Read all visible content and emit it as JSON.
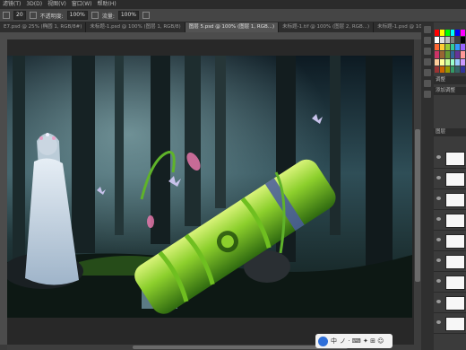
{
  "menubar": {
    "items": [
      "滤镜(T)",
      "3D(D)",
      "视图(V)",
      "窗口(W)",
      "帮助(H)"
    ]
  },
  "options": {
    "size_value": "20",
    "mode_label": "不透明度:",
    "opacity_value": "100%",
    "flow_label": "流量:",
    "flow_value": "100%"
  },
  "tabs": [
    {
      "label": "E7.psd @ 25% (椭圆 1, RGB/8#)",
      "active": false
    },
    {
      "label": "未标题-1.psd @ 100% (图层 1, RGB/8)",
      "active": false
    },
    {
      "label": "图层 5.psd @ 100% (图层 1, RGB...)",
      "active": true
    },
    {
      "label": "未标题-1.tif @ 100% (图层 2, RGB...)",
      "active": false
    },
    {
      "label": "未标题-1.psd @ 100% (RGB/8)",
      "active": false
    },
    {
      "label": "ca256eaef297a5d7d43617c76e7f3a5",
      "active": false
    }
  ],
  "panels": {
    "swatch_colors": [
      "#ff0000",
      "#ffff00",
      "#00ff00",
      "#00ffff",
      "#0000ff",
      "#ff00ff",
      "#ffffff",
      "#e0e0e0",
      "#c0c0c0",
      "#808080",
      "#404040",
      "#000000",
      "#ff6633",
      "#ffcc33",
      "#99cc33",
      "#33cc99",
      "#3399ff",
      "#9966ff",
      "#cc3366",
      "#996633",
      "#669933",
      "#336699",
      "#663399",
      "#ff9999",
      "#ffcc99",
      "#ffff99",
      "#ccff99",
      "#99ffcc",
      "#99ccff",
      "#cc99ff",
      "#993333",
      "#cc6600",
      "#999900",
      "#339966",
      "#336666",
      "#333399"
    ],
    "tab_labels": [
      "调整",
      "添加调整",
      "图层"
    ]
  },
  "ime": {
    "label": "中",
    "extra": "ノ · ⌨ ✦ ⊞ ☺"
  }
}
